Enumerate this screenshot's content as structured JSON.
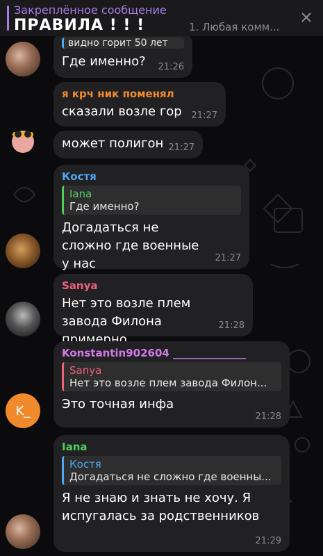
{
  "pinned": {
    "title": "Закреплённое сообщение",
    "text": "ПРАВИЛА ! ! !",
    "preview": "1. Любая комм..."
  },
  "messages": [
    {
      "quote_fragment": "видно горит 50 лет",
      "text": "Где именно?",
      "time": "21:26"
    },
    {
      "sender": "я крч ник поменял",
      "text": "сказали возле гор",
      "time": "21:27"
    },
    {
      "text": "может полигон",
      "time": "21:27"
    },
    {
      "sender": "Костя",
      "reply_name": "Iana",
      "reply_text": "Где именно?",
      "text": "Догадаться не сложно где военные у нас",
      "time": "21:27"
    },
    {
      "sender": "Sanya",
      "text": "Нет это возле плем завода Филона примерно",
      "time": "21:28"
    },
    {
      "sender": "Konstantin902604 ______________",
      "reply_name": "Sanya",
      "reply_text": "Нет это возле плем завода Филон...",
      "text": "Это точная инфа",
      "time": "21:28",
      "avatar_letter": "K_"
    },
    {
      "sender": "Iana",
      "reply_name": "Костя",
      "reply_text": "Догадаться не сложно где военны...",
      "text": "Я не знаю и знать не хочу. Я испугалась за родственников",
      "time": "21:29"
    }
  ],
  "colors": {
    "background": "#0b0b0d",
    "bubble": "#212123",
    "pinned_accent": "#a77ee8",
    "name_iana": "#4fce5d",
    "name_krch": "#f08a2c",
    "name_kostya": "#4fa8f0",
    "name_sanya": "#f0607a",
    "name_konstantin": "#d07ae8"
  }
}
